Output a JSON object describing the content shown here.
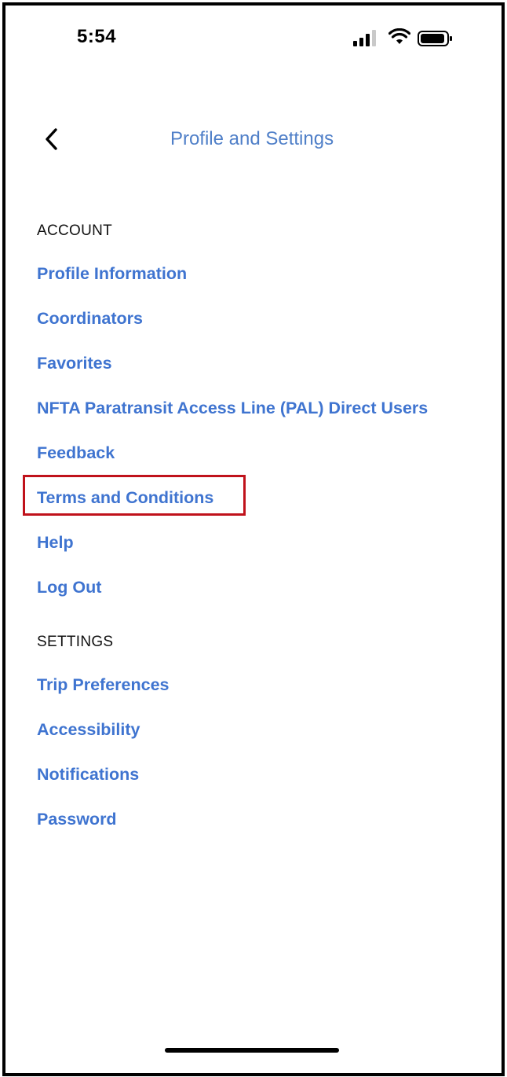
{
  "status_bar": {
    "time": "5:54",
    "icons": [
      "signal-bars-icon",
      "wifi-icon",
      "battery-icon"
    ]
  },
  "header": {
    "back_icon": "chevron-left-icon",
    "title": "Profile and Settings"
  },
  "sections": {
    "account": {
      "title": "ACCOUNT",
      "items": [
        {
          "label": "Profile Information"
        },
        {
          "label": "Coordinators"
        },
        {
          "label": "Favorites"
        },
        {
          "label": "NFTA Paratransit Access Line (PAL) Direct Users"
        },
        {
          "label": "Feedback"
        },
        {
          "label": "Terms and Conditions",
          "highlighted": true
        },
        {
          "label": "Help"
        },
        {
          "label": "Log Out"
        }
      ]
    },
    "settings": {
      "title": "SETTINGS",
      "items": [
        {
          "label": "Trip Preferences"
        },
        {
          "label": "Accessibility"
        },
        {
          "label": "Notifications"
        },
        {
          "label": "Password"
        }
      ]
    }
  },
  "colors": {
    "link": "#3f74d0",
    "title": "#4f7fc8",
    "highlight": "#c0121b"
  }
}
